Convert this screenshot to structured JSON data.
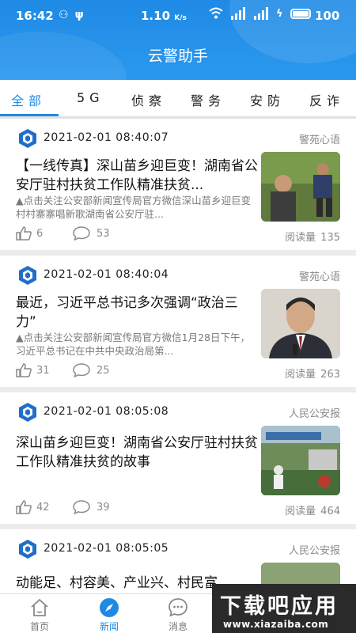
{
  "status_bar": {
    "time": "16:42",
    "speed_value": "1.10",
    "speed_unit": "K/s",
    "battery_level": "100"
  },
  "app": {
    "title": "云警助手"
  },
  "tabs": [
    {
      "label": "全部",
      "active": true
    },
    {
      "label": "5G"
    },
    {
      "label": "侦察"
    },
    {
      "label": "警务"
    },
    {
      "label": "安防"
    },
    {
      "label": "反诈"
    }
  ],
  "feed": [
    {
      "datetime": "2021-02-01  08:40:07",
      "source": "警苑心语",
      "title": "【一线传真】深山苗乡迎巨变！湖南省公安厅驻村扶贫工作队精准扶贫...",
      "summary": "▲点击关注公安部新闻宣传局官方微信深山苗乡迎巨变  村村寨寨唱新歌湖南省公安厅驻...",
      "likes": "6",
      "comments": "53",
      "reads_label": "阅读量",
      "reads": "135"
    },
    {
      "datetime": "2021-02-01  08:40:04",
      "source": "警苑心语",
      "title": "最近，习近平总书记多次强调“政治三力”",
      "summary": "▲点击关注公安部新闻宣传局官方微信1月28日下午，习近平总书记在中共中央政治局第...",
      "likes": "31",
      "comments": "25",
      "reads_label": "阅读量",
      "reads": "263"
    },
    {
      "datetime": "2021-02-01  08:05:08",
      "source": "人民公安报",
      "title": "深山苗乡迎巨变！湖南省公安厅驻村扶贫工作队精准扶贫的故事",
      "summary": "",
      "likes": "42",
      "comments": "39",
      "reads_label": "阅读量",
      "reads": "464"
    },
    {
      "datetime": "2021-02-01  08:05:05",
      "source": "人民公安报",
      "title": "动能足、村容美、产业兴、村民富",
      "summary": "",
      "likes": "",
      "comments": "",
      "reads_label": "",
      "reads": ""
    }
  ],
  "bottom_nav": [
    {
      "label": "首页",
      "icon": "home-icon"
    },
    {
      "label": "新闻",
      "icon": "compass-icon",
      "active": true
    },
    {
      "label": "消息",
      "icon": "chat-icon"
    }
  ],
  "watermark": {
    "main": "下载吧应用",
    "sub": "www.xiazaiba.com"
  },
  "colors": {
    "accent": "#1f8ae5",
    "header": "#2b98ee",
    "muted": "#8a8a8a"
  }
}
